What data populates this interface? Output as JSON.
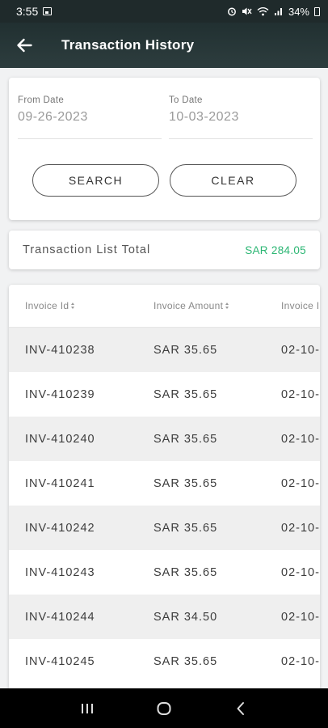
{
  "status_bar": {
    "time": "3:55",
    "battery": "34%"
  },
  "app_bar": {
    "title": "Transaction History"
  },
  "filters": {
    "from_label": "From Date",
    "from_value": "09-26-2023",
    "to_label": "To Date",
    "to_value": "10-03-2023",
    "search_label": "SEARCH",
    "clear_label": "CLEAR"
  },
  "total": {
    "label": "Transaction List Total",
    "value": "SAR 284.05",
    "value_color": "#2bb673"
  },
  "table": {
    "headers": [
      "Invoice Id",
      "Invoice Amount",
      "Invoice I"
    ],
    "rows": [
      [
        "INV-410238",
        "SAR 35.65",
        "02-10-"
      ],
      [
        "INV-410239",
        "SAR 35.65",
        "02-10-"
      ],
      [
        "INV-410240",
        "SAR 35.65",
        "02-10-"
      ],
      [
        "INV-410241",
        "SAR 35.65",
        "02-10-"
      ],
      [
        "INV-410242",
        "SAR 35.65",
        "02-10-"
      ],
      [
        "INV-410243",
        "SAR 35.65",
        "02-10-"
      ],
      [
        "INV-410244",
        "SAR 34.50",
        "02-10-"
      ],
      [
        "INV-410245",
        "SAR 35.65",
        "02-10-"
      ]
    ]
  },
  "icons": {
    "back": "arrow-left-icon",
    "nav_recents": "recents-icon",
    "nav_home": "home-icon",
    "nav_back": "chevron-left-icon"
  }
}
